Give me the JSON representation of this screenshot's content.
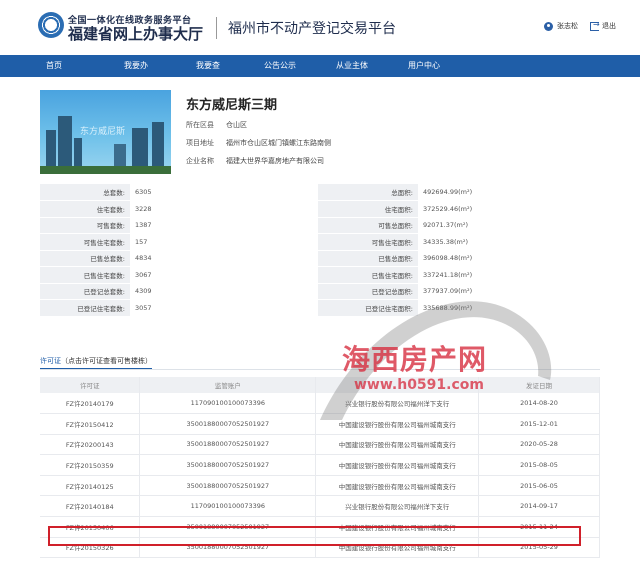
{
  "header": {
    "gov_line1": "全国一体化在线政务服务平台",
    "gov_line2": "福建省网上办事大厅",
    "platform_title": "福州市不动产登记交易平台",
    "user_name": "张志松",
    "logout_label": "退出"
  },
  "nav": {
    "items": [
      {
        "label": "首页"
      },
      {
        "label": "我要办"
      },
      {
        "label": "我要查"
      },
      {
        "label": "公告公示"
      },
      {
        "label": "从业主体"
      },
      {
        "label": "用户中心"
      }
    ]
  },
  "project": {
    "name": "东方威尼斯三期",
    "district_label": "所在区县",
    "district": "仓山区",
    "address_label": "项目地址",
    "address": "福州市仓山区城门镇螺江东路南侧",
    "company_label": "企业名称",
    "company": "福建大世界华嘉房地产有限公司",
    "image_watermark": "东方威尼斯"
  },
  "stats": [
    {
      "k1": "总套数:",
      "v1": "6305",
      "k2": "总面积:",
      "v2": "492694.99(m²)"
    },
    {
      "k1": "住宅套数:",
      "v1": "3228",
      "k2": "住宅面积:",
      "v2": "372529.46(m²)"
    },
    {
      "k1": "可售套数:",
      "v1": "1387",
      "k2": "可售总面积:",
      "v2": "92071.37(m²)"
    },
    {
      "k1": "可售住宅套数:",
      "v1": "157",
      "k2": "可售住宅面积:",
      "v2": "34335.38(m²)"
    },
    {
      "k1": "已售总套数:",
      "v1": "4834",
      "k2": "已售总面积:",
      "v2": "396098.48(m²)"
    },
    {
      "k1": "已售住宅套数:",
      "v1": "3067",
      "k2": "已售住宅面积:",
      "v2": "337241.18(m²)"
    },
    {
      "k1": "已登记总套数:",
      "v1": "4309",
      "k2": "已登记总面积:",
      "v2": "377937.09(m²)"
    },
    {
      "k1": "已登记住宅套数:",
      "v1": "3057",
      "k2": "已登记住宅面积:",
      "v2": "335688.99(m²)"
    }
  ],
  "permit_tab": {
    "title": "许可证",
    "hint": "（点击许可证查看可售楼栋）"
  },
  "permit_table": {
    "headers": [
      "许可证",
      "监管账户",
      "",
      "发证日期"
    ],
    "rows": [
      {
        "permit": "FZ许20140179",
        "account": "117090100100073396",
        "bank": "兴业银行股份有限公司福州洋下支行",
        "date": "2014-08-20"
      },
      {
        "permit": "FZ许20150412",
        "account": "35001880007052501927",
        "bank": "中国建设银行股份有限公司福州城南支行",
        "date": "2015-12-01"
      },
      {
        "permit": "FZ许20200143",
        "account": "35001880007052501927",
        "bank": "中国建设银行股份有限公司福州城南支行",
        "date": "2020-05-28"
      },
      {
        "permit": "FZ许20150359",
        "account": "35001880007052501927",
        "bank": "中国建设银行股份有限公司福州城南支行",
        "date": "2015-08-05"
      },
      {
        "permit": "FZ许20140125",
        "account": "35001880007052501927",
        "bank": "中国建设银行股份有限公司福州城南支行",
        "date": "2015-06-05"
      },
      {
        "permit": "FZ许20140184",
        "account": "117090100100073396",
        "bank": "兴业银行股份有限公司福州洋下支行",
        "date": "2014-09-17"
      },
      {
        "permit": "FZ许20150406",
        "account": "35001880007052501927",
        "bank": "中国建设银行股份有限公司福州城南支行",
        "date": "2015-11-24"
      },
      {
        "permit": "FZ许20150326",
        "account": "35001880007052501927",
        "bank": "中国建设银行股份有限公司福州城南支行",
        "date": "2015-05-29"
      }
    ]
  },
  "watermark": {
    "brand": "海西房产网",
    "url": "www.h0591.com"
  },
  "colors": {
    "nav_bg": "#1f5ea8",
    "highlight_border": "#d0202a",
    "watermark": "#d62a3c"
  }
}
